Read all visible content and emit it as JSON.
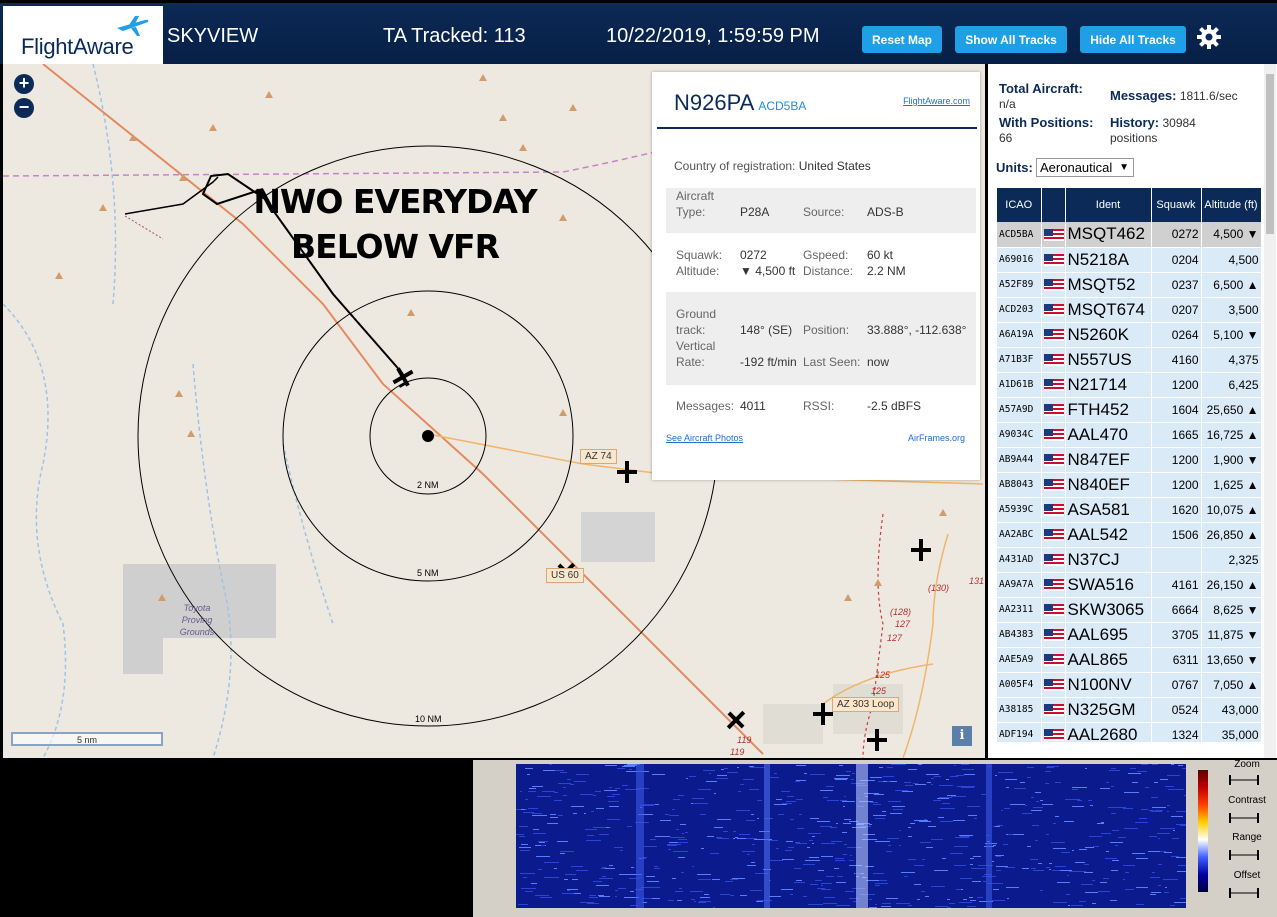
{
  "header": {
    "logo_text": "FlightAware",
    "app_title": "SKYVIEW",
    "ta_tracked": "TA Tracked: 113",
    "datetime": "10/22/2019, 1:59:59 PM",
    "reset_map": "Reset Map",
    "show_all": "Show All Tracks",
    "hide_all": "Hide All Tracks",
    "settings_icon": "gear-icon"
  },
  "map": {
    "zoom_in": "+",
    "zoom_out": "−",
    "overlay_line1": "NWO EVERYDAY",
    "overlay_line2": "BELOW VFR",
    "ring_2": "2 NM",
    "ring_5": "5 NM",
    "ring_10": "10 NM",
    "road_az74": "AZ 74",
    "road_us60": "US 60",
    "road_az303": "AZ 303 Loop",
    "road_130": "(130)",
    "road_128": "(128)",
    "road_127a": "127",
    "road_127b": "127",
    "road_125a": "125",
    "road_125b": "125",
    "road_119a": "119",
    "road_119b": "119",
    "road_131": "131",
    "place_line1": "Toyota",
    "place_line2": "Proving",
    "place_line3": "Grounds",
    "scale": "5 nm",
    "info": "i"
  },
  "detail": {
    "callsign": "N926PA",
    "hex": "ACD5BA",
    "fa_link": "FlightAware.com",
    "country_label": "Country of registration:",
    "country_value": "United States",
    "type_label": "Aircraft Type:",
    "type_value": "P28A",
    "source_label": "Source:",
    "source_value": "ADS-B",
    "squawk_label": "Squawk:",
    "squawk_value": "0272",
    "gspeed_label": "Gspeed:",
    "gspeed_value": "60 kt",
    "altitude_label": "Altitude:",
    "altitude_value": "▼ 4,500 ft",
    "distance_label": "Distance:",
    "distance_value": "2.2 NM",
    "track_label": "Ground track:",
    "track_value": "148° (SE)",
    "position_label": "Position:",
    "position_value": "33.888°, -112.638°",
    "vrate_label": "Vertical Rate:",
    "vrate_value": "-192 ft/min",
    "lastseen_label": "Last Seen:",
    "lastseen_value": "now",
    "messages_label": "Messages:",
    "messages_value": "4011",
    "rssi_label": "RSSI:",
    "rssi_value": "-2.5 dBFS",
    "photos_link": "See Aircraft Photos",
    "airframes_link": "AirFrames.org"
  },
  "panel": {
    "total_label": "Total Aircraft:",
    "total_value": "n/a",
    "messages_label": "Messages:",
    "messages_value": "1811.6/sec",
    "positions_label": "With Positions:",
    "positions_value": "66",
    "history_label": "History:",
    "history_value": "30984 positions",
    "units_label": "Units:",
    "units_value": "Aeronautical",
    "columns": [
      "ICAO",
      "",
      "Ident",
      "Squawk",
      "Altitude (ft)"
    ],
    "rows": [
      {
        "icao": "ACD5BA",
        "ident": "MSQT462",
        "squawk": "0272",
        "alt": "4,500 ▼",
        "selected": true
      },
      {
        "icao": "A69016",
        "ident": "N5218A",
        "squawk": "0204",
        "alt": "4,500"
      },
      {
        "icao": "A52F89",
        "ident": "MSQT52",
        "squawk": "0237",
        "alt": "6,500 ▲"
      },
      {
        "icao": "ACD203",
        "ident": "MSQT674",
        "squawk": "0207",
        "alt": "3,500"
      },
      {
        "icao": "A6A19A",
        "ident": "N5260K",
        "squawk": "0264",
        "alt": "5,100 ▼"
      },
      {
        "icao": "A71B3F",
        "ident": "N557US",
        "squawk": "4160",
        "alt": "4,375"
      },
      {
        "icao": "A1D61B",
        "ident": "N21714",
        "squawk": "1200",
        "alt": "6,425"
      },
      {
        "icao": "A57A9D",
        "ident": "FTH452",
        "squawk": "1604",
        "alt": "25,650 ▲"
      },
      {
        "icao": "A9034C",
        "ident": "AAL470",
        "squawk": "1665",
        "alt": "16,725 ▲"
      },
      {
        "icao": "AB9A44",
        "ident": "N847EF",
        "squawk": "1200",
        "alt": "1,900 ▼"
      },
      {
        "icao": "AB8043",
        "ident": "N840EF",
        "squawk": "1200",
        "alt": "1,625 ▲"
      },
      {
        "icao": "A5939C",
        "ident": "ASA581",
        "squawk": "1620",
        "alt": "10,075 ▲"
      },
      {
        "icao": "AA2ABC",
        "ident": "AAL542",
        "squawk": "1506",
        "alt": "26,850 ▲"
      },
      {
        "icao": "A431AD",
        "ident": "N37CJ",
        "squawk": "",
        "alt": "2,325"
      },
      {
        "icao": "AA9A7A",
        "ident": "SWA516",
        "squawk": "4161",
        "alt": "26,150 ▲"
      },
      {
        "icao": "AA2311",
        "ident": "SKW3065",
        "squawk": "6664",
        "alt": "8,625 ▼"
      },
      {
        "icao": "AB4383",
        "ident": "AAL695",
        "squawk": "3705",
        "alt": "11,875 ▼"
      },
      {
        "icao": "AAE5A9",
        "ident": "AAL865",
        "squawk": "6311",
        "alt": "13,650 ▼"
      },
      {
        "icao": "A005F4",
        "ident": "N100NV",
        "squawk": "0767",
        "alt": "7,050 ▲"
      },
      {
        "icao": "A38185",
        "ident": "N325GM",
        "squawk": "0524",
        "alt": "43,000"
      },
      {
        "icao": "ADF194",
        "ident": "AAL2680",
        "squawk": "1324",
        "alt": "35,000"
      }
    ]
  },
  "waterfall": {
    "zoom": "Zoom",
    "contrast": "Contrast",
    "range": "Range",
    "offset": "Offset"
  }
}
